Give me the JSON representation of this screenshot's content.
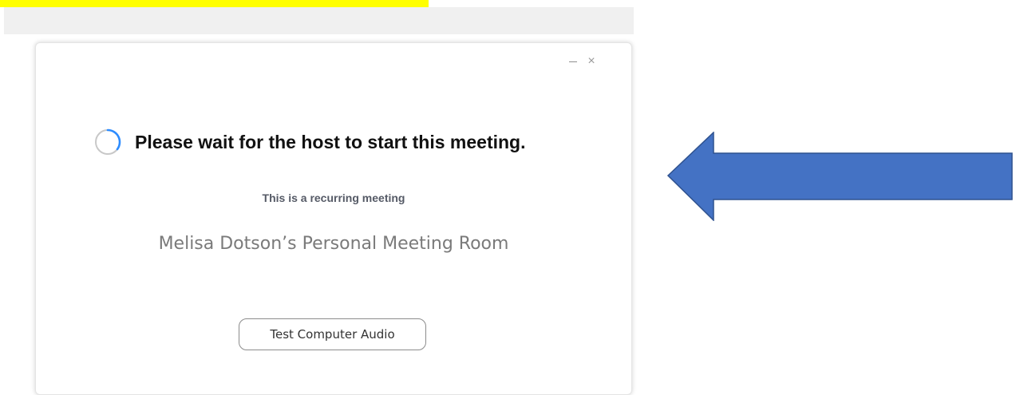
{
  "dialog": {
    "window_controls": {
      "minimize_icon": "minimize-icon",
      "close_icon": "close-icon",
      "close_glyph": "×"
    },
    "status_message": "Please wait for the host to start this meeting.",
    "spinner_icon": "loading-spinner-icon",
    "recurring_label": "This is a recurring meeting",
    "meeting_name": "Melisa Dotson’s Personal Meeting Room",
    "test_audio_button": "Test Computer Audio"
  },
  "annotations": {
    "highlight_color": "#ffff00",
    "arrow_color": "#4472c4",
    "arrow_icon": "left-arrow-icon"
  },
  "colors": {
    "spinner_accent": "#2d8cff",
    "spinner_track": "#c8c8c8"
  }
}
